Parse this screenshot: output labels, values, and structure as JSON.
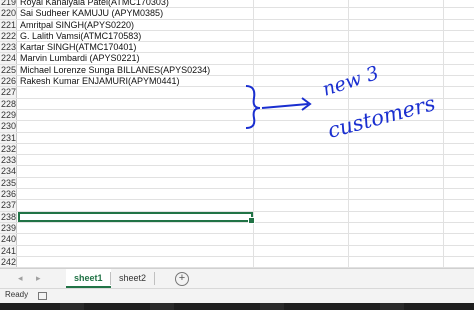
{
  "rows": [
    {
      "num": "219",
      "text": "Royal Kanaiyala Patel(ATMC170303)"
    },
    {
      "num": "220",
      "text": "Sai Sudheer KAMUJU (APYM0385)"
    },
    {
      "num": "221",
      "text": "Amritpal SINGH(APYS0220)"
    },
    {
      "num": "222",
      "text": "G. Lalith Vamsi(ATMC170583)"
    },
    {
      "num": "223",
      "text": "Kartar SINGH(ATMC170401)"
    },
    {
      "num": "224",
      "text": "Marvin Lumbardi (APYS0221)"
    },
    {
      "num": "225",
      "text": "Michael Lorenze Sunga BILLANES(APYS0234)"
    },
    {
      "num": "226",
      "text": "Rakesh Kumar ENJAMURI(APYM0441)"
    },
    {
      "num": "227",
      "text": ""
    },
    {
      "num": "228",
      "text": ""
    },
    {
      "num": "229",
      "text": ""
    },
    {
      "num": "230",
      "text": ""
    },
    {
      "num": "231",
      "text": ""
    },
    {
      "num": "232",
      "text": ""
    },
    {
      "num": "233",
      "text": ""
    },
    {
      "num": "234",
      "text": ""
    },
    {
      "num": "235",
      "text": ""
    },
    {
      "num": "236",
      "text": ""
    },
    {
      "num": "237",
      "text": ""
    },
    {
      "num": "238",
      "text": ""
    },
    {
      "num": "239",
      "text": ""
    },
    {
      "num": "240",
      "text": ""
    },
    {
      "num": "241",
      "text": ""
    },
    {
      "num": "242",
      "text": ""
    }
  ],
  "selected_row": "238",
  "annotation": {
    "line1": "new 3",
    "line2": "customers"
  },
  "sheets": [
    {
      "label": "sheet1",
      "active": true
    },
    {
      "label": "sheet2",
      "active": false
    }
  ],
  "nav": {
    "prev": "◂",
    "next": "▸",
    "add": "+"
  },
  "status": {
    "text": "Ready"
  },
  "colors": {
    "accent": "#217346",
    "ink": "#1a2fd0"
  }
}
